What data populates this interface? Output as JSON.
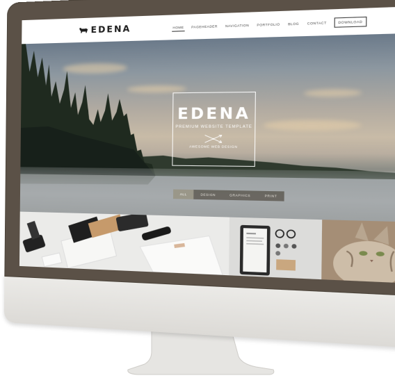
{
  "site": {
    "logo_text": "EDENA",
    "nav": [
      {
        "label": "Home",
        "active": true
      },
      {
        "label": "Pageheader",
        "active": false
      },
      {
        "label": "Navigation",
        "active": false
      },
      {
        "label": "Portfolio",
        "active": false
      },
      {
        "label": "Blog",
        "active": false
      },
      {
        "label": "Contact",
        "active": false
      },
      {
        "label": "Download",
        "active": false
      }
    ]
  },
  "hero": {
    "title": "EDENA",
    "subtitle": "PREMIUM WEBSITE TEMPLATE",
    "tagline": "AWESOME WEB DESIGN"
  },
  "filters": [
    {
      "label": "All",
      "active": true
    },
    {
      "label": "Design",
      "active": false
    },
    {
      "label": "Graphics",
      "active": false
    },
    {
      "label": "Print",
      "active": false
    }
  ],
  "colors": {
    "bezel": "#5b5147",
    "chin": "#e5e4e1",
    "filter_bar": "#5f5c54"
  }
}
